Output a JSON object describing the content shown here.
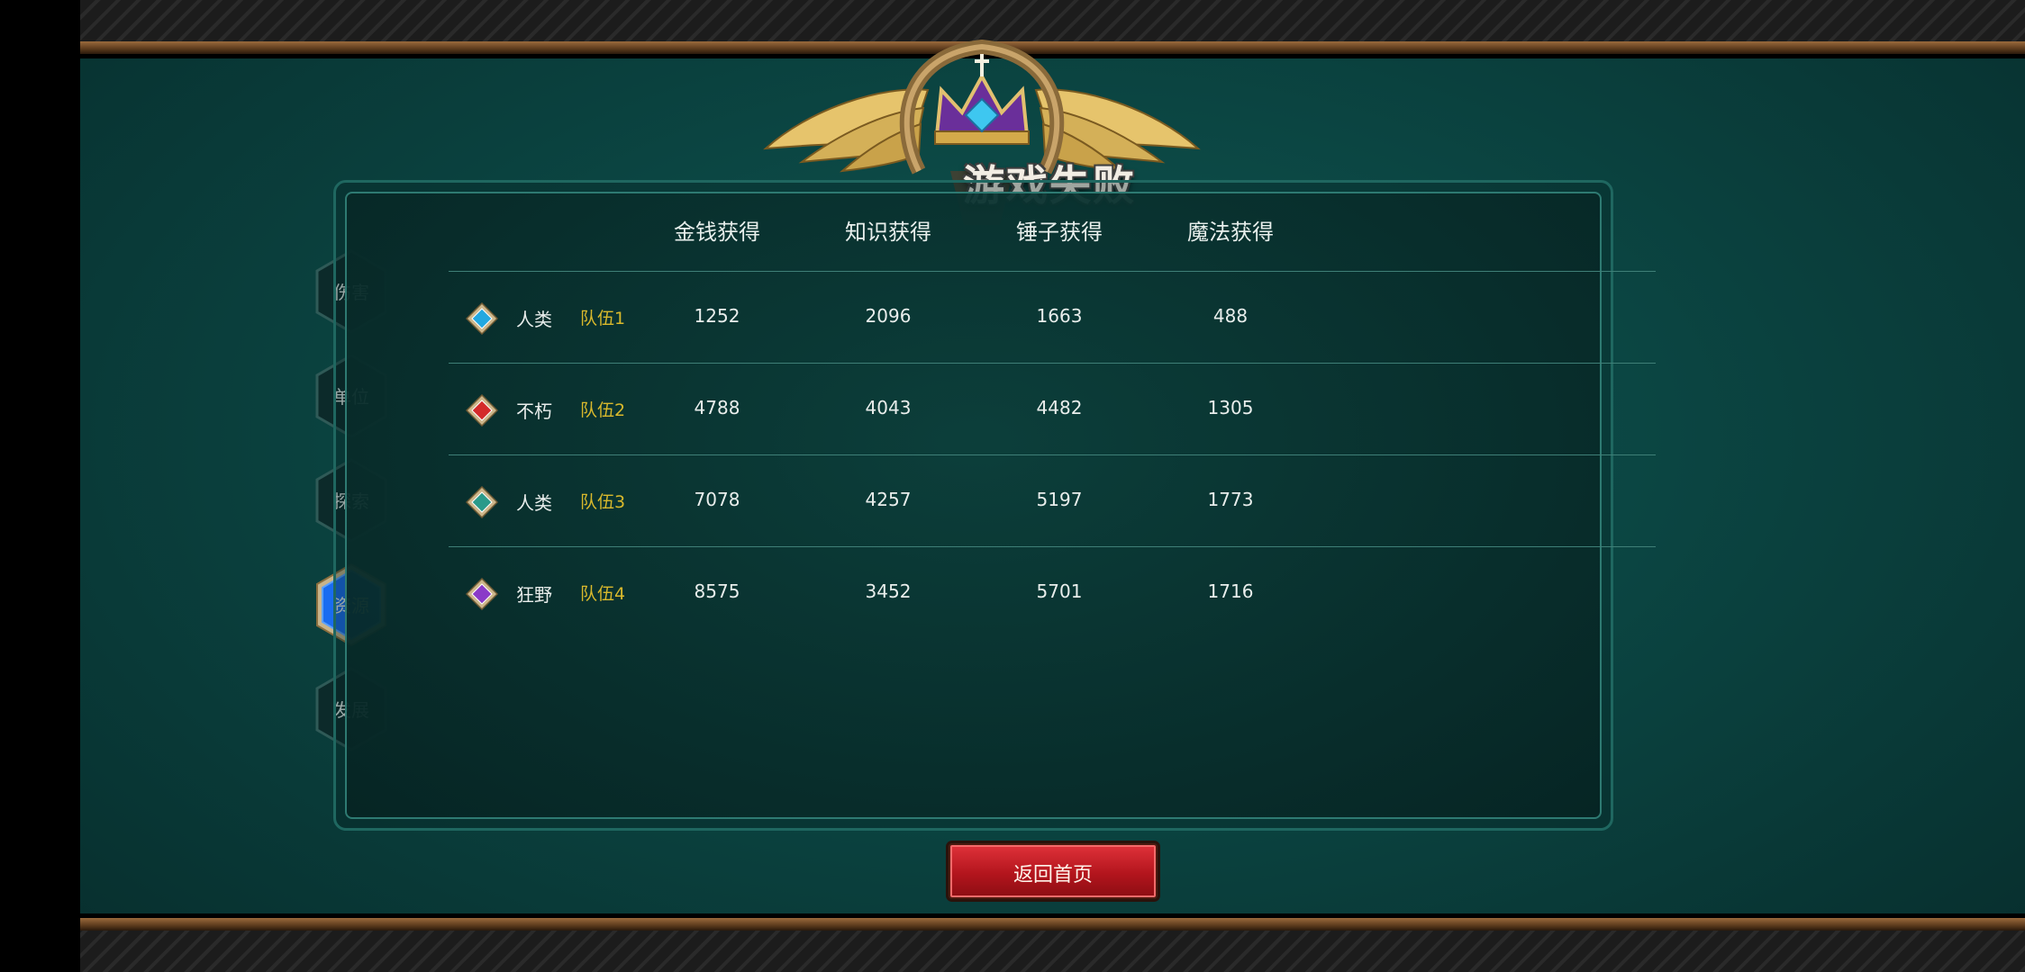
{
  "title": "游戏失败",
  "tabs": [
    {
      "label": "伤害",
      "active": false
    },
    {
      "label": "单位",
      "active": false
    },
    {
      "label": "探索",
      "active": false
    },
    {
      "label": "资源",
      "active": true
    },
    {
      "label": "发展",
      "active": false
    }
  ],
  "table": {
    "columns": [
      "金钱获得",
      "知识获得",
      "锤子获得",
      "魔法获得"
    ],
    "rows": [
      {
        "gem_icon": "diamond-gem-icon",
        "gem_color": "#22a8e0",
        "race": "人类",
        "team": "队伍1",
        "values": [
          "1252",
          "2096",
          "1663",
          "488"
        ]
      },
      {
        "gem_icon": "diamond-gem-icon",
        "gem_color": "#d42a2a",
        "race": "不朽",
        "team": "队伍2",
        "values": [
          "4788",
          "4043",
          "4482",
          "1305"
        ]
      },
      {
        "gem_icon": "diamond-gem-icon",
        "gem_color": "#2a9a8a",
        "race": "人类",
        "team": "队伍3",
        "values": [
          "7078",
          "4257",
          "5197",
          "1773"
        ]
      },
      {
        "gem_icon": "diamond-gem-icon",
        "gem_color": "#8a3ac8",
        "race": "狂野",
        "team": "队伍4",
        "values": [
          "8575",
          "3452",
          "5701",
          "1716"
        ]
      }
    ]
  },
  "return_button": {
    "label": "返回首页"
  },
  "colors": {
    "accent_tab": "#1a6cf0",
    "team_label": "#d9b92c",
    "button_red": "#c8202a"
  }
}
